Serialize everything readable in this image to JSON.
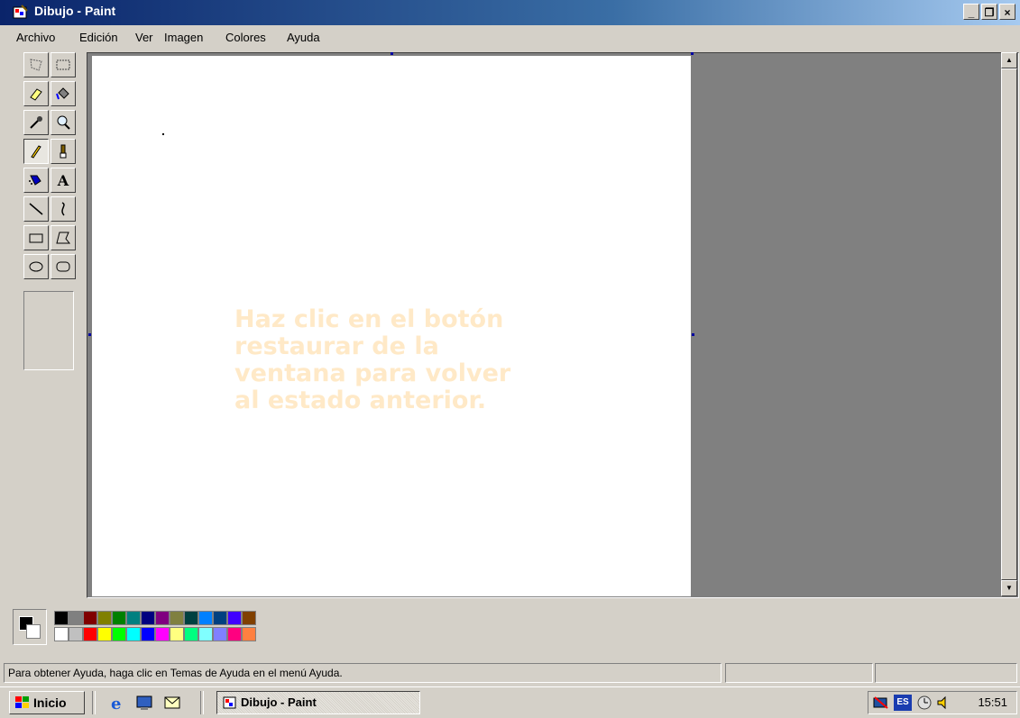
{
  "window": {
    "title": "Dibujo - Paint"
  },
  "menu": [
    "Archivo",
    "Edición",
    "Ver",
    "Imagen",
    "Colores",
    "Ayuda"
  ],
  "tools": [
    {
      "name": "free-select",
      "icon": "free-select-icon"
    },
    {
      "name": "rect-select",
      "icon": "rect-select-icon"
    },
    {
      "name": "eraser",
      "icon": "eraser-icon"
    },
    {
      "name": "fill",
      "icon": "paint-bucket-icon"
    },
    {
      "name": "color-picker",
      "icon": "eyedropper-icon"
    },
    {
      "name": "magnifier",
      "icon": "magnifier-icon"
    },
    {
      "name": "pencil",
      "icon": "pencil-icon"
    },
    {
      "name": "brush",
      "icon": "brush-icon"
    },
    {
      "name": "airbrush",
      "icon": "airbrush-icon"
    },
    {
      "name": "text",
      "icon": "text-icon",
      "glyph": "A"
    },
    {
      "name": "line",
      "icon": "line-icon"
    },
    {
      "name": "curve",
      "icon": "curve-icon"
    },
    {
      "name": "rectangle",
      "icon": "rectangle-icon"
    },
    {
      "name": "polygon",
      "icon": "polygon-icon"
    },
    {
      "name": "ellipse",
      "icon": "ellipse-icon"
    },
    {
      "name": "rounded-rectangle",
      "icon": "rounded-rect-icon"
    }
  ],
  "selected_tool": "pencil",
  "canvas": {
    "overlay_text": "Haz clic en el botón\nrestaurar de la\nventana para volver\nal estado anterior."
  },
  "palette": {
    "foreground": "#000000",
    "background": "#ffffff",
    "top": [
      "#000000",
      "#808080",
      "#800000",
      "#808000",
      "#008000",
      "#008080",
      "#000080",
      "#800080",
      "#808040",
      "#004040",
      "#0080ff",
      "#004080",
      "#4000ff",
      "#804000"
    ],
    "bottom": [
      "#ffffff",
      "#c0c0c0",
      "#ff0000",
      "#ffff00",
      "#00ff00",
      "#00ffff",
      "#0000ff",
      "#ff00ff",
      "#ffff80",
      "#00ff80",
      "#80ffff",
      "#8080ff",
      "#ff0080",
      "#ff8040"
    ]
  },
  "status": {
    "help": "Para obtener Ayuda, haga clic en Temas de Ayuda en el menú Ayuda."
  },
  "taskbar": {
    "start_label": "Inicio",
    "quick_launch": [
      "internet-explorer-icon",
      "show-desktop-icon",
      "outlook-express-icon"
    ],
    "task_label": "Dibujo - Paint",
    "tray": {
      "language": "ES",
      "clock": "15:51"
    }
  }
}
